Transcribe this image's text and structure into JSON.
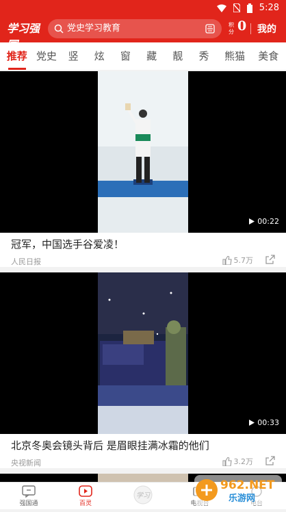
{
  "status": {
    "time": "5:28"
  },
  "header": {
    "logo_text": "学习强国",
    "search_placeholder": "党史学习教育",
    "points_label": "积分",
    "points_value": "0",
    "mine_label": "我的"
  },
  "tabs": [
    "推荐",
    "党史",
    "竖",
    "炫",
    "窗",
    "藏",
    "靓",
    "秀",
    "熊猫",
    "美食"
  ],
  "feed": [
    {
      "title": "冠军，中国选手谷爱凌！",
      "source": "人民日报",
      "likes": "5.7万",
      "duration": "00:22"
    },
    {
      "title": "北京冬奥会镜头背后 是眉眼挂满冰霜的他们",
      "source": "央视新闻",
      "likes": "3.2万",
      "duration": "00:33"
    }
  ],
  "bottom_nav": [
    {
      "label": "强国通",
      "icon": "message-icon"
    },
    {
      "label": "百灵",
      "icon": "video-play-icon"
    },
    {
      "label": "",
      "icon": "xuexi-logo-icon"
    },
    {
      "label": "电视台",
      "icon": "tv-icon"
    },
    {
      "label": "电台",
      "icon": "radio-icon"
    }
  ],
  "watermark": {
    "text": "962.NET",
    "subtext": "乐游网"
  },
  "colors": {
    "brand_red": "#e1251b"
  }
}
